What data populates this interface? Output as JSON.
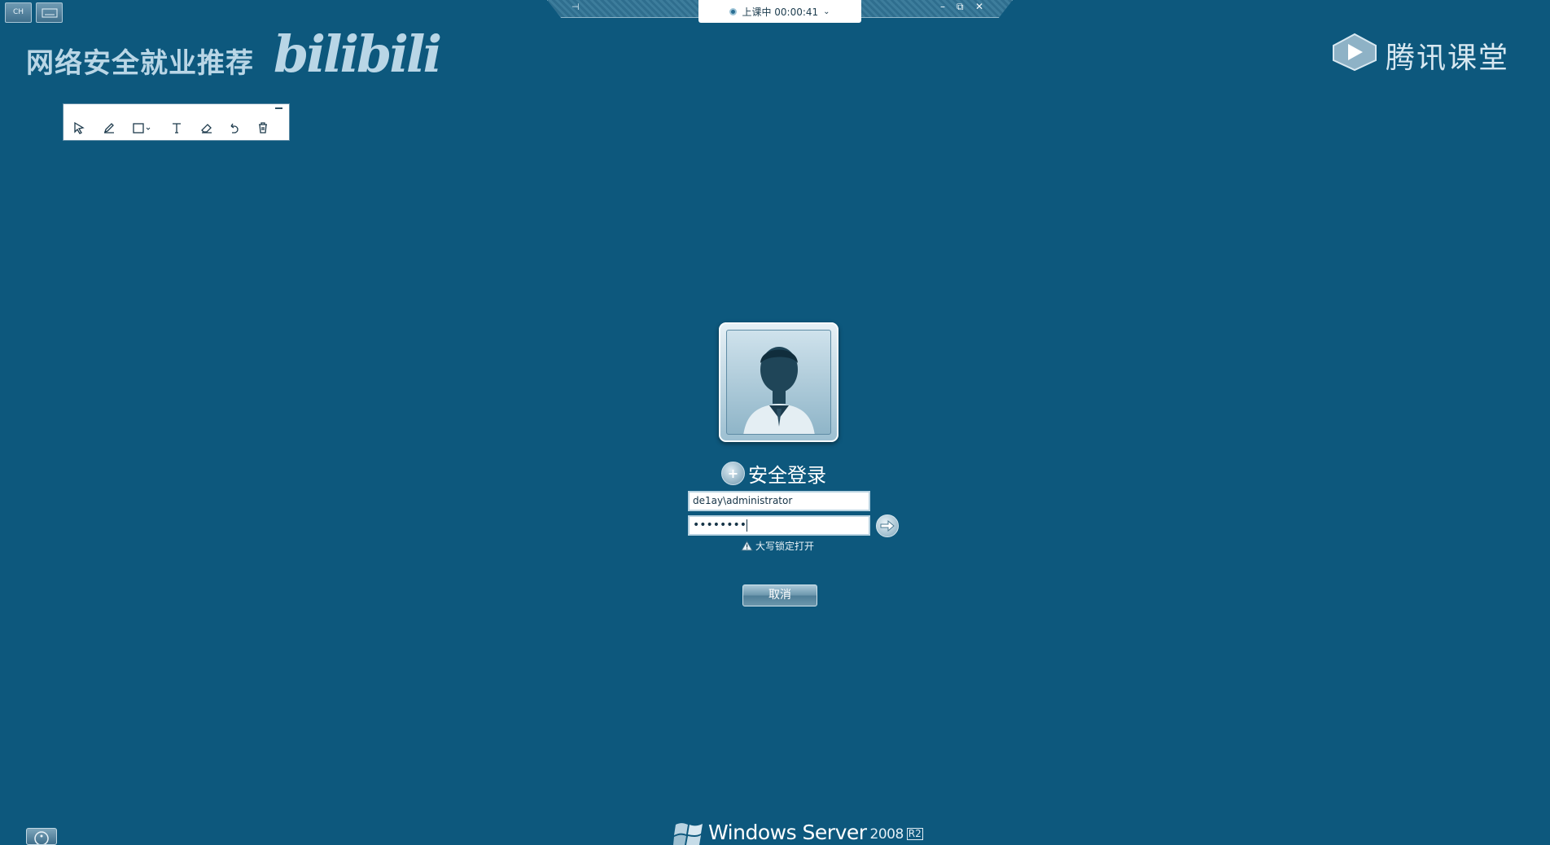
{
  "corner_buttons": [
    {
      "label": "CH",
      "icon": "keyboard-language-icon"
    },
    {
      "label": "",
      "icon": "keyboard-icon"
    }
  ],
  "remote_bar": {
    "session_status": "上课中 00:00:41",
    "controls": [
      "–",
      "⧉",
      "✕"
    ]
  },
  "watermark": {
    "left_text": "网络安全就业推荐",
    "bilibili_logo": "bilibili",
    "platform_name": "腾讯课堂"
  },
  "toolbar": {
    "tools": [
      "select-arrow-icon",
      "pen-icon",
      "shape-rectangle-icon",
      "text-tool-icon",
      "eraser-icon",
      "undo-icon",
      "trash-icon"
    ]
  },
  "login": {
    "title": "安全登录",
    "username_value": "de1ay\\administrator",
    "password_mask": "••••••••",
    "caps_lock_warning": "大写锁定打开",
    "cancel_label": "取消"
  },
  "footer": {
    "brand_name": "Windows Server",
    "brand_year": "2008",
    "brand_edition": "R2"
  },
  "colors": {
    "background": "#0d587d",
    "text": "#ffffff",
    "toolbar_bg": "#ffffff"
  }
}
